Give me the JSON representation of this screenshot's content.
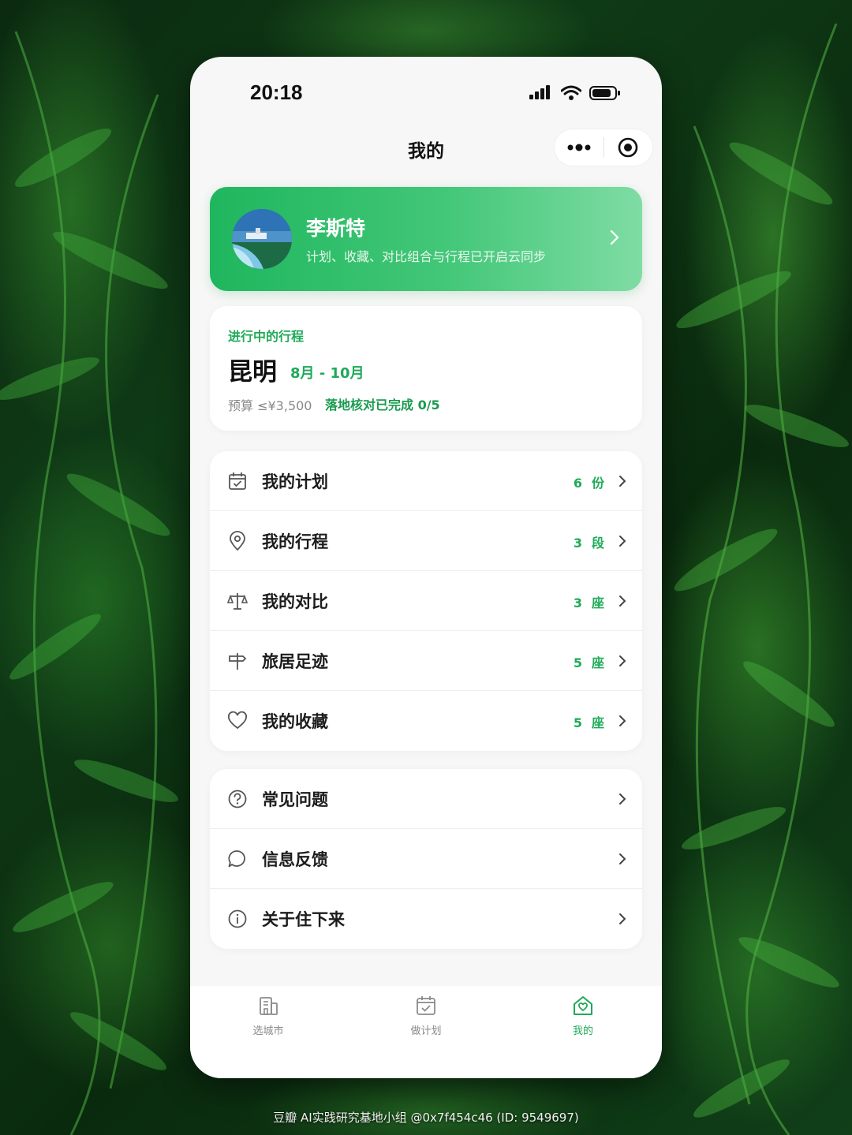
{
  "status_bar": {
    "time": "20:18"
  },
  "header": {
    "title": "我的"
  },
  "profile": {
    "name": "李斯特",
    "subtitle": "计划、收藏、对比组合与行程已开启云同步"
  },
  "active_trip": {
    "label": "进行中的行程",
    "city": "昆明",
    "months": "8月 - 10月",
    "budget": "预算 ≤¥3,500",
    "check_status": "落地核对已完成 0/5"
  },
  "menu_main": [
    {
      "label": "我的计划",
      "count": "6",
      "unit": "份",
      "icon": "calendar-check-icon"
    },
    {
      "label": "我的行程",
      "count": "3",
      "unit": "段",
      "icon": "location-pin-icon"
    },
    {
      "label": "我的对比",
      "count": "3",
      "unit": "座",
      "icon": "balance-scale-icon"
    },
    {
      "label": "旅居足迹",
      "count": "5",
      "unit": "座",
      "icon": "signpost-icon"
    },
    {
      "label": "我的收藏",
      "count": "5",
      "unit": "座",
      "icon": "heart-icon"
    }
  ],
  "menu_help": [
    {
      "label": "常见问题",
      "icon": "question-circle-icon"
    },
    {
      "label": "信息反馈",
      "icon": "chat-bubble-icon"
    },
    {
      "label": "关于住下来",
      "icon": "info-circle-icon"
    }
  ],
  "tab_bar": [
    {
      "label": "选城市",
      "icon": "building-icon",
      "active": false
    },
    {
      "label": "做计划",
      "icon": "calendar-check-icon",
      "active": false
    },
    {
      "label": "我的",
      "icon": "home-heart-icon",
      "active": true
    }
  ],
  "colors": {
    "accent": "#1faa59",
    "card_gradient_start": "#1fb65e",
    "card_gradient_end": "#7fdca4"
  },
  "footer": {
    "credit": "豆瓣  AI实践研究基地小组 @0x7f454c46 (ID: 9549697)"
  }
}
